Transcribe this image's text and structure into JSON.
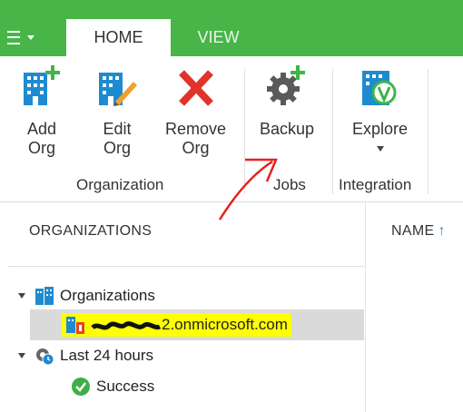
{
  "app": {
    "menu_icon": "hamburger-menu-icon",
    "tabs": [
      {
        "label": "HOME",
        "active": true
      },
      {
        "label": "VIEW",
        "active": false
      }
    ],
    "accent_color": "#48b549"
  },
  "ribbon": {
    "buttons": [
      {
        "label": "Add\nOrg",
        "line1": "Add",
        "line2": "Org",
        "icon": "building-plus-icon"
      },
      {
        "label": "Edit\nOrg",
        "line1": "Edit",
        "line2": "Org",
        "icon": "building-pencil-icon"
      },
      {
        "label": "Remove\nOrg",
        "line1": "Remove",
        "line2": "Org",
        "icon": "red-x-icon"
      },
      {
        "label": "Backup",
        "line1": "Backup",
        "icon": "gear-plus-icon"
      },
      {
        "label": "Explore",
        "line1": "Explore",
        "icon": "building-explore-icon"
      }
    ],
    "groups": [
      "Organization",
      "Jobs",
      "Integration"
    ]
  },
  "left_pane": {
    "title": "ORGANIZATIONS",
    "tree": [
      {
        "label": "Organizations",
        "icon": "organizations-icon",
        "expanded": true
      },
      {
        "label_suffix": "2.onmicrosoft.com",
        "icon": "office-org-icon",
        "selected": true,
        "highlighted": true
      },
      {
        "label": "Last 24 hours",
        "icon": "clock-gear-icon",
        "expanded": true
      },
      {
        "label": "Success",
        "icon": "success-check-icon"
      }
    ]
  },
  "right_pane": {
    "column_header": "NAME",
    "sort_icon": "sort-ascending-icon"
  }
}
